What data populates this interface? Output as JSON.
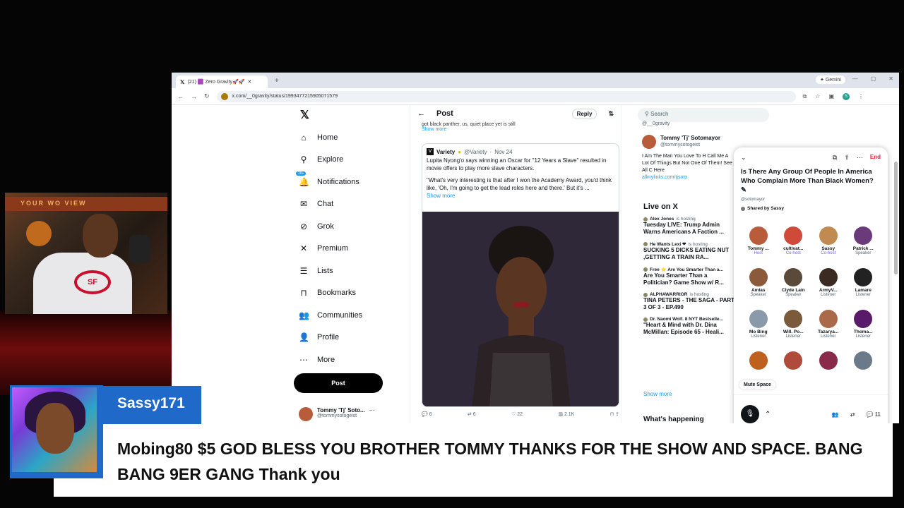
{
  "browser": {
    "tab_title": "(21) 🟪 Zero Gravity🚀🚀",
    "gemini_label": "Gemini",
    "url": "x.com/__0gravity/status/1993477215905071579",
    "profile_initial": "S"
  },
  "nav": {
    "items": [
      {
        "label": "Home",
        "icon": "⌂"
      },
      {
        "label": "Explore",
        "icon": "⚲"
      },
      {
        "label": "Notifications",
        "icon": "🔔"
      },
      {
        "label": "Chat",
        "icon": "✉"
      },
      {
        "label": "Grok",
        "icon": "⊘"
      },
      {
        "label": "Premium",
        "icon": "✕"
      },
      {
        "label": "Lists",
        "icon": "☰"
      },
      {
        "label": "Bookmarks",
        "icon": "⊓"
      },
      {
        "label": "Communities",
        "icon": "👥"
      },
      {
        "label": "Profile",
        "icon": "👤"
      },
      {
        "label": "More",
        "icon": "⋯"
      }
    ],
    "notif_badge": "20+",
    "post_button": "Post",
    "account_name": "Tommy 'Tj' Soto...",
    "account_handle": "@tommysotogeist"
  },
  "feed": {
    "header": "Post",
    "reply_button": "Reply",
    "snippet": "got black panther, us, quiet place yet is still",
    "show_more": "Show more",
    "quote": {
      "author": "Variety",
      "handle": "@Variety",
      "date": "Nov 24",
      "text1": "Lupita Nyong'o says winning an Oscar for \"12 Years a Slave\" resulted in movie offers to play more slave characters.",
      "text2": "\"What's very interesting is that after I won the Academy Award, you'd think like, 'Oh, I'm going to get the lead roles here and there.' But it's ...",
      "show_more": "Show more"
    },
    "actions": {
      "replies": "6",
      "reposts": "6",
      "likes": "22",
      "views": "2.1K"
    }
  },
  "right": {
    "search_placeholder": "Search",
    "top_handle": "@__0gravity",
    "profile": {
      "name": "Tommy 'Tj' Sotomayor",
      "handle": "@tommysotogeist",
      "bio": "I Am The Man You Love To H Call Me A Lot Of Things But Not One Of Them! See All C Here",
      "link": "allmylinks.com/tjsoto"
    },
    "live_title": "Live on X",
    "live_items": [
      {
        "host": "Alex Jones",
        "status": "is hosting",
        "title": "Tuesday LIVE: Trump Admin Warns Americans A Faction ..."
      },
      {
        "host": "He Wants Lexi ❤",
        "status": "is hosting",
        "title": "SUCKING 5 DICKS EATING NUT ,GETTING A TRAIN RA..."
      },
      {
        "host": "Free ⭐ Are You Smarter Than a...",
        "status": "",
        "title": "Are You Smarter Than a Politician? Game Show w/ R..."
      },
      {
        "host": "ALPHAWARRIOR",
        "status": "is hosting",
        "title": "TINA PETERS - THE SAGA - PART 3 OF 3 - EP.490"
      },
      {
        "host": "Dr. Naomi Wolf. 8 NYT Bestselle...",
        "status": "",
        "title": "\"Heart & Mind with Dr. Dina McMillan: Episode 65 - Heali..."
      }
    ],
    "show_more": "Show more",
    "whats_happening": "What's happening"
  },
  "space": {
    "end_label": "End",
    "title": "Is There Any Group Of People In America Who Complain More Than Black Women?",
    "subtitle": "@sotomayor",
    "shared_by": "Shared by Sassy",
    "participants": [
      {
        "name": "Tommy ...",
        "role": "Host",
        "color": "#b85c3c"
      },
      {
        "name": "cultivat...",
        "role": "Co-host",
        "color": "#d04a3a"
      },
      {
        "name": "Sassy",
        "role": "Co-host",
        "color": "#c08a50"
      },
      {
        "name": "Patrick ...",
        "role": "Speaker",
        "color": "#6a3a7a"
      },
      {
        "name": "Amias",
        "role": "Speaker",
        "color": "#8a5a3a"
      },
      {
        "name": "Clyde Lain",
        "role": "Speaker",
        "color": "#5a4a3a"
      },
      {
        "name": "ArmyV...",
        "role": "Listener",
        "color": "#3a2a22"
      },
      {
        "name": "Lamare",
        "role": "Listener",
        "color": "#222222"
      },
      {
        "name": "Mo Bing",
        "role": "Listener",
        "color": "#8a9aaa"
      },
      {
        "name": "Will. Po...",
        "role": "Listener",
        "color": "#7a5a3a"
      },
      {
        "name": "Tazarya...",
        "role": "Listener",
        "color": "#aa6a4a"
      },
      {
        "name": "Thoma...",
        "role": "Listener",
        "color": "#5a1a6a"
      },
      {
        "name": "",
        "role": "",
        "color": "#c0601e"
      },
      {
        "name": "",
        "role": "",
        "color": "#b04a3a"
      },
      {
        "name": "",
        "role": "",
        "color": "#8a2a4a"
      },
      {
        "name": "",
        "role": "",
        "color": "#6a7a8a"
      }
    ],
    "mute_label": "Mute Space",
    "reply_count": "11"
  },
  "overlay": {
    "donor_name": "Sassy171",
    "message": "Mobing80 $5 GOD BLESS YOU BROTHER TOMMY THANKS FOR THE SHOW AND SPACE. BANG BANG 9ER GANG Thank you",
    "webcam_sign": "YOUR WO      VIEW",
    "shirt_logo": "SF"
  }
}
